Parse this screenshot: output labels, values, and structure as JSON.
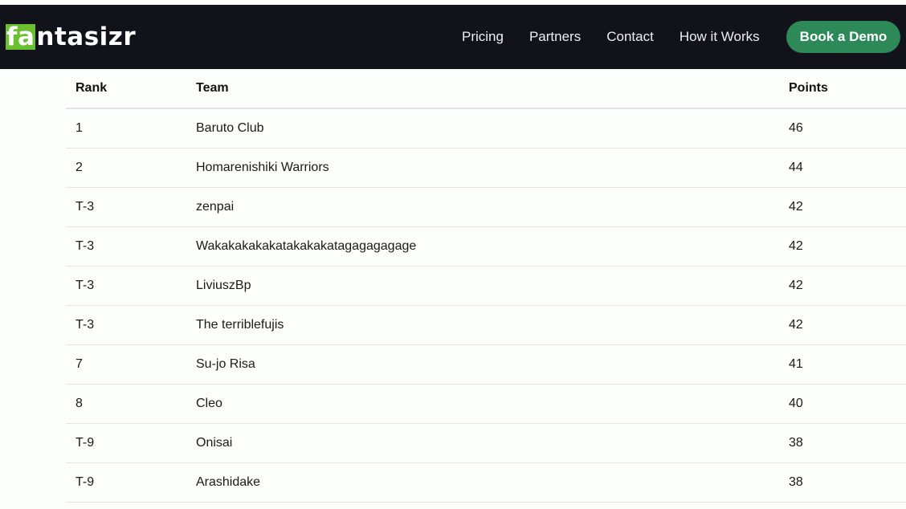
{
  "logo": {
    "highlight": "fa",
    "rest": "ntasizr"
  },
  "nav": {
    "links": [
      "Pricing",
      "Partners",
      "Contact",
      "How it Works"
    ],
    "cta": "Book a Demo"
  },
  "table": {
    "headers": {
      "rank": "Rank",
      "team": "Team",
      "points": "Points"
    },
    "rows": [
      {
        "rank": "1",
        "team": "Baruto Club",
        "points": "46"
      },
      {
        "rank": "2",
        "team": "Homarenishiki Warriors",
        "points": "44"
      },
      {
        "rank": "T-3",
        "team": "zenpai",
        "points": "42"
      },
      {
        "rank": "T-3",
        "team": "Wakakakakakatakakakatagagagagage",
        "points": "42"
      },
      {
        "rank": "T-3",
        "team": "LiviuszBp",
        "points": "42"
      },
      {
        "rank": "T-3",
        "team": "The terriblefujis",
        "points": "42"
      },
      {
        "rank": "7",
        "team": "Su-jo Risa",
        "points": "41"
      },
      {
        "rank": "8",
        "team": "Cleo",
        "points": "40"
      },
      {
        "rank": "T-9",
        "team": "Onisai",
        "points": "38"
      },
      {
        "rank": "T-9",
        "team": "Arashidake",
        "points": "38"
      }
    ]
  }
}
